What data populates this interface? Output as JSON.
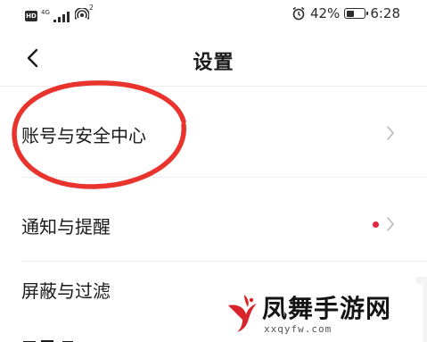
{
  "status_bar": {
    "hd_badge": "HD",
    "network": "4G",
    "hotspot_count": "2",
    "battery_percent": "42%",
    "battery_level": 0.42,
    "time": "6:28"
  },
  "header": {
    "title": "设置"
  },
  "settings": {
    "items": [
      {
        "label": "账号与安全中心"
      },
      {
        "label": "通知与提醒"
      },
      {
        "label": "屏蔽与过滤"
      }
    ]
  },
  "colors": {
    "annotation_red": "#e8342c",
    "notification_dot": "#e3273a",
    "watermark_red": "#d9242b"
  },
  "watermark": {
    "title": "凤舞手游网",
    "url": "xxqyfw.com"
  }
}
